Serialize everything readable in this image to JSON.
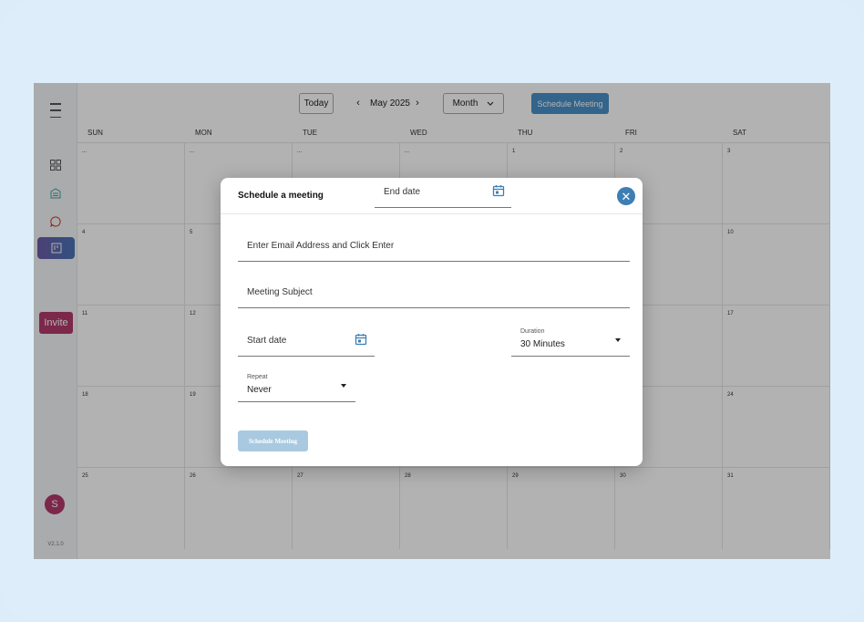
{
  "sidebar": {
    "invite_label": "Invite",
    "avatar_initial": "S",
    "version": "V2.1.0"
  },
  "toolbar": {
    "today_label": "Today",
    "prev_glyph": "‹",
    "month_label": "May 2025",
    "next_glyph": "›",
    "view_label": "Month",
    "view_chevron": "⌄",
    "schedule_label": "Schedule Meeting"
  },
  "calendar": {
    "days_of_week": [
      "SUN",
      "MON",
      "TUE",
      "WED",
      "THU",
      "FRI",
      "SAT"
    ],
    "weeks": [
      [
        "...",
        "...",
        "...",
        "...",
        "1",
        "2",
        "3"
      ],
      [
        "4",
        "5",
        "",
        "",
        "",
        "",
        "10"
      ],
      [
        "11",
        "12",
        "",
        "",
        "",
        "",
        "17"
      ],
      [
        "18",
        "19",
        "",
        "",
        "",
        "",
        "24"
      ],
      [
        "25",
        "26",
        "27",
        "28",
        "29",
        "30",
        "31"
      ]
    ]
  },
  "modal": {
    "title": "Schedule a meeting",
    "close_glyph": "✕",
    "email_placeholder": "Enter Email Address and Click Enter",
    "subject_placeholder": "Meeting Subject",
    "start_date_label": "Start date",
    "end_date_label": "End date",
    "duration_label": "Duration",
    "duration_value": "30 Minutes",
    "repeat_label": "Repeat",
    "repeat_value": "Never",
    "submit_label": "Schedule Meeting"
  },
  "colors": {
    "accent": "#4a90c8",
    "invite": "#b23a6b",
    "close": "#3d7fb5",
    "submit_disabled": "#a9c9e0"
  }
}
